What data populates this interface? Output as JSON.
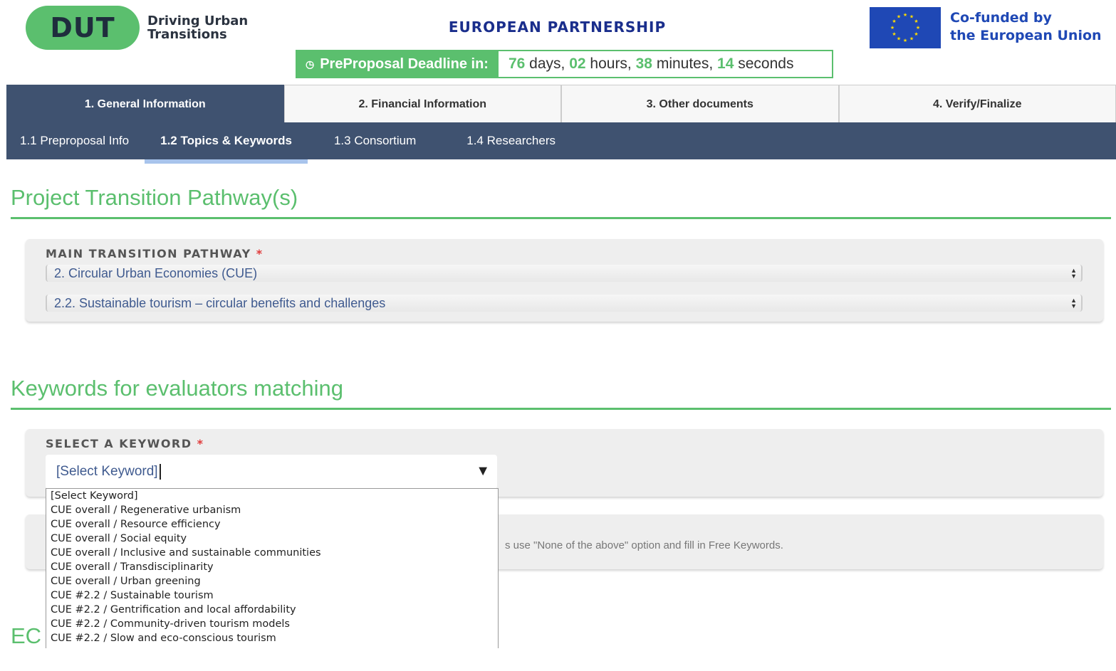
{
  "header": {
    "logo_mark": "DUT",
    "logo_text_line1": "Driving Urban",
    "logo_text_line2": "Transitions",
    "partnership": "EUROPEAN PARTNERSHIP",
    "cofunded_line1": "Co-funded by",
    "cofunded_line2": "the European Union"
  },
  "deadline": {
    "label": "PreProposal Deadline in:",
    "days": "76",
    "days_unit": "days,",
    "hours": "02",
    "hours_unit": "hours,",
    "minutes": "38",
    "minutes_unit": "minutes,",
    "seconds": "14",
    "seconds_unit": "seconds"
  },
  "main_tabs": [
    {
      "label": "1. General Information"
    },
    {
      "label": "2. Financial Information"
    },
    {
      "label": "3. Other documents"
    },
    {
      "label": "4. Verify/Finalize"
    }
  ],
  "sub_tabs": [
    {
      "label": "1.1 Preproposal Info"
    },
    {
      "label": "1.2 Topics & Keywords"
    },
    {
      "label": "1.3 Consortium"
    },
    {
      "label": "1.4 Researchers"
    }
  ],
  "section_pathway": {
    "title": "Project Transition Pathway(s)",
    "field_label": "MAIN TRANSITION PATHWAY",
    "required_mark": "*",
    "pathway_value": "2. Circular Urban Economies (CUE)",
    "subpathway_value": "2.2. Sustainable tourism – circular benefits and challenges"
  },
  "section_keywords": {
    "title": "Keywords for evaluators matching",
    "field_label": "SELECT A KEYWORD",
    "required_mark": "*",
    "combo_value": "[Select Keyword]",
    "hint_fragment": "s use \"None of the above\" option and fill in Free Keywords.",
    "options": [
      "[Select Keyword]",
      "CUE overall / Regenerative urbanism",
      "CUE overall / Resource efficiency",
      "CUE overall / Social equity",
      "CUE overall / Inclusive and sustainable communities",
      "CUE overall / Transdisciplinarity",
      "CUE overall / Urban greening",
      "CUE #2.2 / Sustainable tourism",
      "CUE #2.2 / Gentrification and local affordability",
      "CUE #2.2 / Community-driven tourism models",
      "CUE #2.2 / Slow and eco-conscious tourism"
    ]
  },
  "next_section_partial": "EC",
  "colors": {
    "brand_green": "#5bbf6e",
    "nav_blue": "#3f5270",
    "eu_blue": "#1f48b5",
    "required_red": "#e03a3a"
  },
  "icons": {
    "deadline": "clock-icon",
    "flag": "eu-flag-icon",
    "select_arrows": "updown-arrows-icon",
    "combo_arrow": "triangle-down-icon"
  }
}
